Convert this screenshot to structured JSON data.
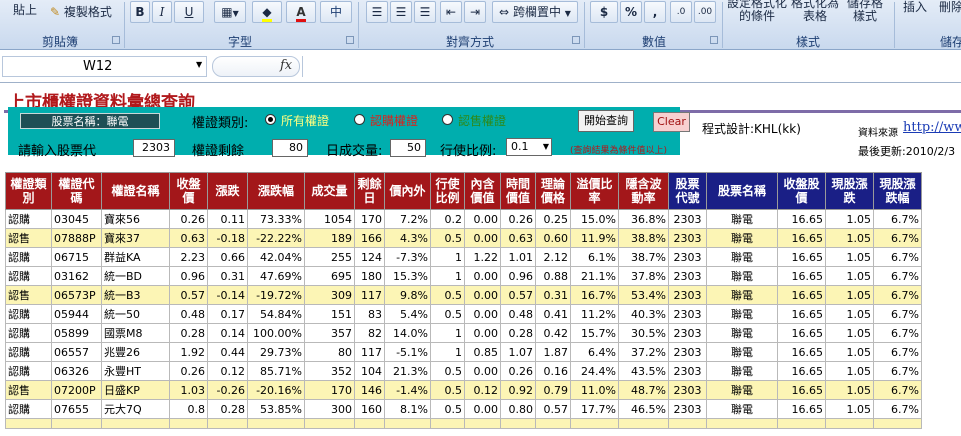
{
  "ribbon": {
    "paste_label": "貼上",
    "format_painter_label": "複製格式",
    "bold": "B",
    "italic": "I",
    "underline": "U",
    "merge_center_label": "跨欄置中",
    "currency": "$",
    "percent": "%",
    "comma": ",",
    "cond_format_label": "設定格式化\n的條件",
    "format_table_label": "格式化為\n表格",
    "cell_style_label": "儲存格\n樣式",
    "insert_label": "插入",
    "delete_label": "刪除",
    "groups": [
      "剪貼簿",
      "字型",
      "對齊方式",
      "數值",
      "樣式",
      "儲存"
    ]
  },
  "formula_bar": {
    "cell_ref": "W12",
    "fx": "fx",
    "formula": ""
  },
  "panel": {
    "title": "上市櫃權證資料彙總查詢",
    "stock_name_label": "股票名稱：聯電",
    "warrant_type_label": "權證類別:",
    "options": [
      "所有權證",
      "認購權證",
      "認售權證"
    ],
    "selected_option": "所有權證",
    "stock_code_label": "請輸入股票代",
    "stock_code": "2303",
    "remaining_label": "權證剩餘",
    "remaining": "80",
    "volume_label": "日成交量:",
    "volume": "50",
    "ratio_label": "行使比例:",
    "ratio": "0.1",
    "hint": "(查詢結果為條件值以上)",
    "run_button": "開始查詢",
    "clear_button": "Clear",
    "designer": "程式設計:KHL(kk)",
    "source_label": "資料來源",
    "source_link": "http://ww",
    "last_update": "最後更新:2010/2/3"
  },
  "table": {
    "headers": [
      "權證類\n別",
      "權證代\n碼",
      "權證名稱",
      "收盤\n價",
      "漲跌",
      "漲跌幅",
      "成交量",
      "剩餘\n日",
      "價內外",
      "行使\n比例",
      "內含\n價值",
      "時間\n價值",
      "理論\n價格",
      "溢價比\n率",
      "隱含波\n動率",
      "股票\n代號",
      "股票名稱",
      "收盤股\n價",
      "現股漲\n跌",
      "現股漲\n跌幅"
    ],
    "rows": [
      [
        "認購",
        "03045",
        "寶來56",
        "0.26",
        "0.11",
        "73.33%",
        "1054",
        "170",
        "7.2%",
        "0.2",
        "0.00",
        "0.26",
        "0.25",
        "15.0%",
        "36.8%",
        "2303",
        "聯電",
        "16.65",
        "1.05",
        "6.7%"
      ],
      [
        "認售",
        "07888P",
        "寶來37",
        "0.63",
        "-0.18",
        "-22.22%",
        "189",
        "166",
        "4.3%",
        "0.5",
        "0.00",
        "0.63",
        "0.60",
        "11.9%",
        "38.8%",
        "2303",
        "聯電",
        "16.65",
        "1.05",
        "6.7%"
      ],
      [
        "認購",
        "06715",
        "群益KA",
        "2.23",
        "0.66",
        "42.04%",
        "255",
        "124",
        "-7.3%",
        "1",
        "1.22",
        "1.01",
        "2.12",
        "6.1%",
        "38.7%",
        "2303",
        "聯電",
        "16.65",
        "1.05",
        "6.7%"
      ],
      [
        "認購",
        "03162",
        "統一BD",
        "0.96",
        "0.31",
        "47.69%",
        "695",
        "180",
        "15.3%",
        "1",
        "0.00",
        "0.96",
        "0.88",
        "21.1%",
        "37.8%",
        "2303",
        "聯電",
        "16.65",
        "1.05",
        "6.7%"
      ],
      [
        "認售",
        "06573P",
        "統一B3",
        "0.57",
        "-0.14",
        "-19.72%",
        "309",
        "117",
        "9.8%",
        "0.5",
        "0.00",
        "0.57",
        "0.31",
        "16.7%",
        "53.4%",
        "2303",
        "聯電",
        "16.65",
        "1.05",
        "6.7%"
      ],
      [
        "認購",
        "05944",
        "統一50",
        "0.48",
        "0.17",
        "54.84%",
        "151",
        "83",
        "5.4%",
        "0.5",
        "0.00",
        "0.48",
        "0.41",
        "11.2%",
        "40.3%",
        "2303",
        "聯電",
        "16.65",
        "1.05",
        "6.7%"
      ],
      [
        "認購",
        "05899",
        "國票M8",
        "0.28",
        "0.14",
        "100.00%",
        "357",
        "82",
        "14.0%",
        "1",
        "0.00",
        "0.28",
        "0.42",
        "15.7%",
        "30.5%",
        "2303",
        "聯電",
        "16.65",
        "1.05",
        "6.7%"
      ],
      [
        "認購",
        "06557",
        "兆豐26",
        "1.92",
        "0.44",
        "29.73%",
        "80",
        "117",
        "-5.1%",
        "1",
        "0.85",
        "1.07",
        "1.87",
        "6.4%",
        "37.2%",
        "2303",
        "聯電",
        "16.65",
        "1.05",
        "6.7%"
      ],
      [
        "認購",
        "06326",
        "永豐HT",
        "0.26",
        "0.12",
        "85.71%",
        "352",
        "104",
        "21.3%",
        "0.5",
        "0.00",
        "0.26",
        "0.16",
        "24.4%",
        "43.5%",
        "2303",
        "聯電",
        "16.65",
        "1.05",
        "6.7%"
      ],
      [
        "認售",
        "07200P",
        "日盛KP",
        "1.03",
        "-0.26",
        "-20.16%",
        "170",
        "146",
        "-1.4%",
        "0.5",
        "0.12",
        "0.92",
        "0.79",
        "11.0%",
        "48.7%",
        "2303",
        "聯電",
        "16.65",
        "1.05",
        "6.7%"
      ],
      [
        "認購",
        "07655",
        "元大7Q",
        "0.8",
        "0.28",
        "53.85%",
        "300",
        "160",
        "8.1%",
        "0.5",
        "0.00",
        "0.80",
        "0.57",
        "17.7%",
        "46.5%",
        "2303",
        "聯電",
        "16.65",
        "1.05",
        "6.7%"
      ]
    ]
  },
  "colors": {
    "header_red": "#a3171a",
    "header_blue": "#1a1f86",
    "row_yellow": "#fcf5b5",
    "panel_teal": "#00aeae"
  }
}
